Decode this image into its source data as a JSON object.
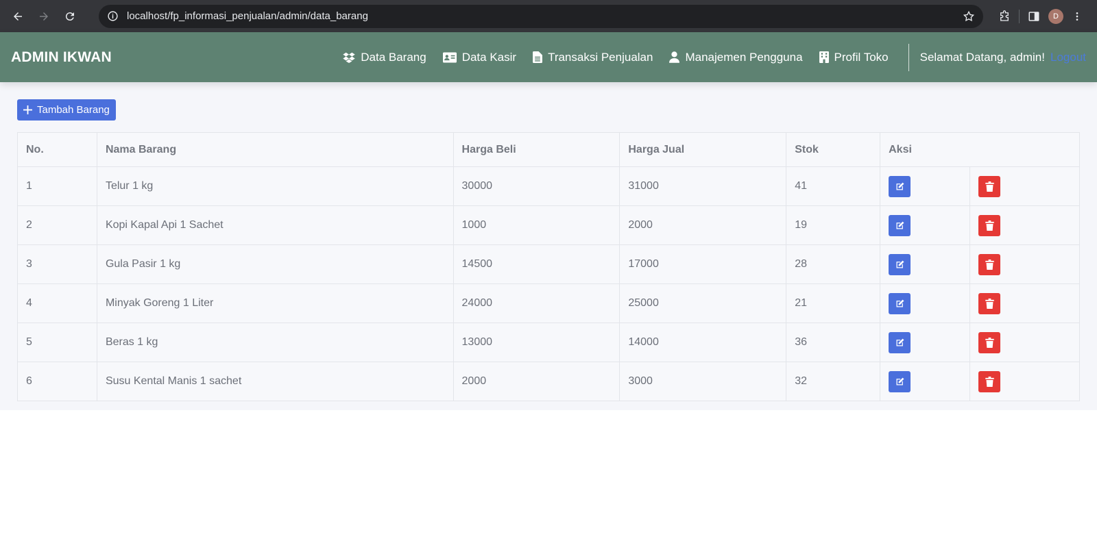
{
  "browser": {
    "url": "localhost/fp_informasi_penjualan/admin/data_barang",
    "profile_initial": "D"
  },
  "navbar": {
    "brand": "ADMIN IKWAN",
    "items": [
      {
        "label": "Data Barang",
        "icon": "dropbox-icon"
      },
      {
        "label": "Data Kasir",
        "icon": "id-card-icon"
      },
      {
        "label": "Transaksi Penjualan",
        "icon": "file-icon"
      },
      {
        "label": "Manajemen Pengguna",
        "icon": "user-icon"
      },
      {
        "label": "Profil Toko",
        "icon": "building-icon"
      }
    ],
    "welcome": "Selamat Datang, admin!",
    "logout": "Logout"
  },
  "main": {
    "add_button": "Tambah Barang",
    "table": {
      "headers": [
        "No.",
        "Nama Barang",
        "Harga Beli",
        "Harga Jual",
        "Stok",
        "Aksi"
      ],
      "rows": [
        {
          "no": "1",
          "nama": "Telur 1 kg",
          "beli": "30000",
          "jual": "31000",
          "stok": "41"
        },
        {
          "no": "2",
          "nama": "Kopi Kapal Api 1 Sachet",
          "beli": "1000",
          "jual": "2000",
          "stok": "19"
        },
        {
          "no": "3",
          "nama": "Gula Pasir 1 kg",
          "beli": "14500",
          "jual": "17000",
          "stok": "28"
        },
        {
          "no": "4",
          "nama": "Minyak Goreng 1 Liter",
          "beli": "24000",
          "jual": "25000",
          "stok": "21"
        },
        {
          "no": "5",
          "nama": "Beras 1 kg",
          "beli": "13000",
          "jual": "14000",
          "stok": "36"
        },
        {
          "no": "6",
          "nama": "Susu Kental Manis 1 sachet",
          "beli": "2000",
          "jual": "3000",
          "stok": "32"
        }
      ]
    }
  },
  "colors": {
    "navbar_bg": "#5e8272",
    "primary": "#4a6fdc",
    "danger": "#e53935",
    "link": "#4c7bd9"
  }
}
